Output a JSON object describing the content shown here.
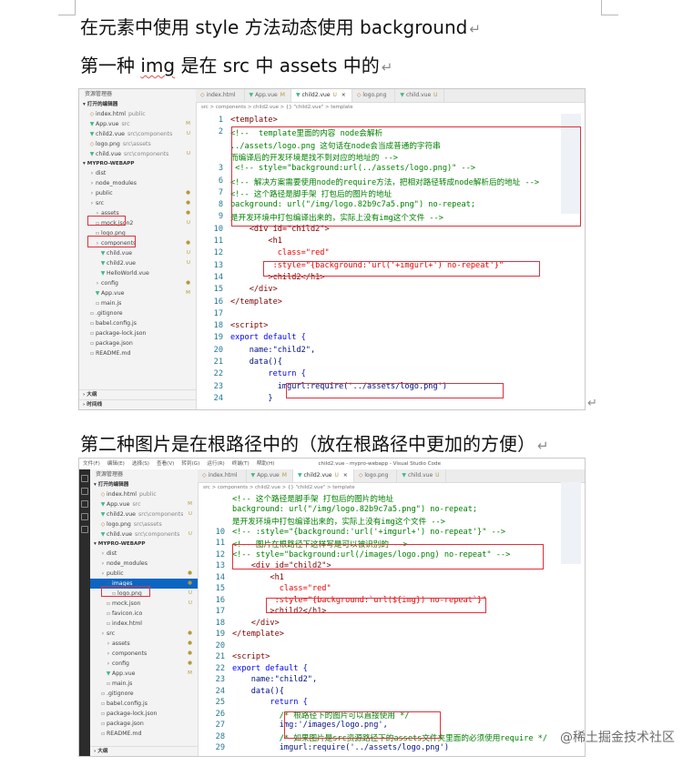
{
  "doc": {
    "heading_1": "在元素中使用 style 方法动态使用 background",
    "heading_2_parts": [
      "第一种 ",
      "img",
      " 是在 src 中 assets 中的"
    ],
    "heading_3": "第二种图片是在根路径中的（放在根路径中更加的方便）",
    "para_mark": "↵"
  },
  "shot1": {
    "explorer_title": "资源管理器",
    "open_editors": "打开的编辑器",
    "open_files": [
      {
        "name": "index.html",
        "path": "public",
        "badge": ""
      },
      {
        "name": "App.vue",
        "path": "src",
        "badge": "M"
      },
      {
        "name": "child2.vue",
        "path": "src\\components",
        "badge": "U"
      },
      {
        "name": "logo.png",
        "path": "src\\assets",
        "badge": ""
      },
      {
        "name": "child.vue",
        "path": "src\\components",
        "badge": "U"
      }
    ],
    "project": "MYPRO-WEBAPP",
    "tree": [
      {
        "name": "dist",
        "badge": ""
      },
      {
        "name": "node_modules",
        "badge": ""
      },
      {
        "name": "public",
        "badge": "●"
      },
      {
        "name": "src",
        "badge": "●"
      },
      {
        "name": "assets",
        "badge": "●"
      },
      {
        "name": "mock.json2",
        "badge": "U"
      },
      {
        "name": "logo.png",
        "badge": ""
      },
      {
        "name": "components",
        "badge": "●"
      },
      {
        "name": "child.vue",
        "badge": "U"
      },
      {
        "name": "child2.vue",
        "badge": "U"
      },
      {
        "name": "HelloWorld.vue",
        "badge": ""
      },
      {
        "name": "config",
        "badge": "●"
      },
      {
        "name": "App.vue",
        "badge": "M"
      },
      {
        "name": "main.js",
        "badge": ""
      },
      {
        "name": ".gitignore",
        "badge": ""
      },
      {
        "name": "babel.config.js",
        "badge": ""
      },
      {
        "name": "package-lock.json",
        "badge": ""
      },
      {
        "name": "package.json",
        "badge": ""
      },
      {
        "name": "README.md",
        "badge": ""
      }
    ],
    "bottom_sections": [
      "大纲",
      "时间线"
    ],
    "tabs": [
      {
        "label": "index.html",
        "mark": ""
      },
      {
        "label": "App.vue",
        "mark": "M"
      },
      {
        "label": "child2.vue",
        "mark": "U"
      },
      {
        "label": "logo.png",
        "mark": ""
      },
      {
        "label": "child.vue",
        "mark": "U"
      }
    ],
    "breadcrumb": "src > components > child2.vue > {} \"child2.vue\" > template",
    "code": [
      {
        "n": "1",
        "t": "<template>"
      },
      {
        "n": "2",
        "t": "<!--  template里面的内容 node会解析"
      },
      {
        "n": "",
        "t": "../assets/logo.png 这句话在node会当成普通的字符串"
      },
      {
        "n": "",
        "t": "而编译后的开发环境是找不到对应的地址的 -->"
      },
      {
        "n": "3",
        "t": " <!-- style=\"background:url(../assets/logo.png)\" -->"
      },
      {
        "n": "6",
        "t": "<!-- 解决方案需要使用node的require方法，把相对路径转成node解析后的地址 -->"
      },
      {
        "n": "7",
        "t": "<!-- 这个路径是脚手架 打包后的图片的地址"
      },
      {
        "n": "8",
        "t": "background: url(\"/img/logo.82b9c7a5.png\") no-repeat;"
      },
      {
        "n": "9",
        "t": "是开发环境中打包编译出来的，实际上没有img这个文件 -->"
      },
      {
        "n": "10",
        "t": "    <div id=\"child2\">"
      },
      {
        "n": "11",
        "t": "        <h1"
      },
      {
        "n": "12",
        "t": "          class=\"red\""
      },
      {
        "n": "13",
        "t": "         :style=\"{background:'url('+imgurl+') no-repeat'}\""
      },
      {
        "n": "14",
        "t": "        >child2</h1>"
      },
      {
        "n": "15",
        "t": "    </div>"
      },
      {
        "n": "16",
        "t": "</template>"
      },
      {
        "n": "17",
        "t": ""
      },
      {
        "n": "18",
        "t": "<script>"
      },
      {
        "n": "19",
        "t": "export default {"
      },
      {
        "n": "20",
        "t": "    name:\"child2\","
      },
      {
        "n": "21",
        "t": "    data(){"
      },
      {
        "n": "22",
        "t": "        return {"
      },
      {
        "n": "23",
        "t": "          imgurl:require('../assets/logo.png')"
      },
      {
        "n": "24",
        "t": "        }"
      }
    ]
  },
  "shot2": {
    "titlebar": [
      "文件(F)",
      "编辑(E)",
      "选择(S)",
      "查看(V)",
      "转到(G)",
      "运行(R)",
      "终端(T)",
      "帮助(H)",
      "child2.vue - mypro-webapp - Visual Studio Code"
    ],
    "explorer_title": "资源管理器",
    "open_editors": "打开的编辑器",
    "open_files": [
      {
        "name": "index.html",
        "path": "public",
        "badge": ""
      },
      {
        "name": "App.vue",
        "path": "src",
        "badge": "M"
      },
      {
        "name": "child2.vue",
        "path": "src\\components",
        "badge": "U"
      },
      {
        "name": "logo.png",
        "path": "src\\assets",
        "badge": ""
      },
      {
        "name": "child.vue",
        "path": "src\\components",
        "badge": "U"
      }
    ],
    "project": "MYPRO-WEBAPP",
    "tree": [
      {
        "name": "dist",
        "badge": ""
      },
      {
        "name": "node_modules",
        "badge": ""
      },
      {
        "name": "public",
        "badge": "●"
      },
      {
        "name": "images",
        "badge": "●"
      },
      {
        "name": "logo.png",
        "badge": "U"
      },
      {
        "name": "mock.json",
        "badge": "U"
      },
      {
        "name": "favicon.ico",
        "badge": ""
      },
      {
        "name": "index.html",
        "badge": ""
      },
      {
        "name": "src",
        "badge": "●"
      },
      {
        "name": "assets",
        "badge": "●"
      },
      {
        "name": "components",
        "badge": "●"
      },
      {
        "name": "config",
        "badge": "●"
      },
      {
        "name": "App.vue",
        "badge": "M"
      },
      {
        "name": "main.js",
        "badge": ""
      },
      {
        "name": ".gitignore",
        "badge": ""
      },
      {
        "name": "babel.config.js",
        "badge": ""
      },
      {
        "name": "package-lock.json",
        "badge": ""
      },
      {
        "name": "package.json",
        "badge": ""
      },
      {
        "name": "README.md",
        "badge": ""
      }
    ],
    "bottom_sections": [
      "大纲"
    ],
    "tabs": [
      {
        "label": "index.html",
        "mark": ""
      },
      {
        "label": "App.vue",
        "mark": "M"
      },
      {
        "label": "child2.vue",
        "mark": "U"
      },
      {
        "label": "logo.png",
        "mark": ""
      },
      {
        "label": "child.vue",
        "mark": "U"
      }
    ],
    "breadcrumb": "src > components > child2.vue > {} \"child2.vue\" > template",
    "code": [
      {
        "n": "",
        "t": "<!-- 这个路径是脚手架 打包后的图片的地址"
      },
      {
        "n": "",
        "t": "background: url(\"/img/logo.82b9c7a5.png\") no-repeat;"
      },
      {
        "n": "",
        "t": "是开发环境中打包编译出来的，实际上没有img这个文件 -->"
      },
      {
        "n": "10",
        "t": "<!-- :style=\"{background:'url('+imgurl+') no-repeat'}\" -->"
      },
      {
        "n": "11",
        "t": "<!-- 图片在根路径下这样写是可以被识别的 -->"
      },
      {
        "n": "12",
        "t": "<!-- style=\"background:url(/images/logo.png) no-repeat\" -->"
      },
      {
        "n": "13",
        "t": "    <div id=\"child2\">"
      },
      {
        "n": "14",
        "t": "        <h1"
      },
      {
        "n": "15",
        "t": "          class=\"red\""
      },
      {
        "n": "16",
        "t": "         :style=\"{background:`url(${img}) no-repeat`}\""
      },
      {
        "n": "17",
        "t": "        >child2</h1>"
      },
      {
        "n": "18",
        "t": "    </div>"
      },
      {
        "n": "19",
        "t": "</template>"
      },
      {
        "n": "20",
        "t": ""
      },
      {
        "n": "21",
        "t": "<script>"
      },
      {
        "n": "22",
        "t": "export default {"
      },
      {
        "n": "23",
        "t": "    name:\"child2\","
      },
      {
        "n": "24",
        "t": "    data(){"
      },
      {
        "n": "25",
        "t": "        return {"
      },
      {
        "n": "26",
        "t": "          /* 根路径下的图片可以直接使用 */"
      },
      {
        "n": "27",
        "t": "          img:'/images/logo.png',"
      },
      {
        "n": "28",
        "t": "          /* 如果图片是src资源路径下的assets文件夹里面的必须使用require */"
      },
      {
        "n": "29",
        "t": "          imgurl:require('../assets/logo.png')"
      }
    ]
  },
  "watermark": "@稀土掘金技术社区"
}
